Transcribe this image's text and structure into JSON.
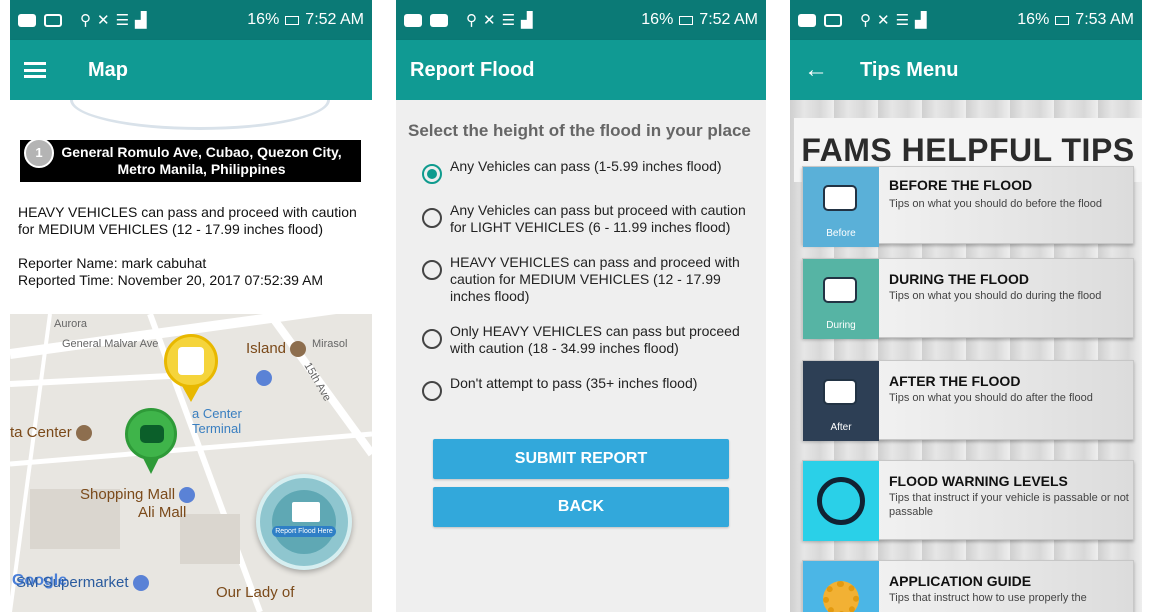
{
  "status": {
    "battery": "16%",
    "time1": "7:52 AM",
    "time2": "7:52 AM",
    "time3": "7:53 AM"
  },
  "map_screen": {
    "title": "Map",
    "compass": "1",
    "address": "General Romulo Ave, Cubao, Quezon City, Metro Manila, Philippines",
    "description": "HEAVY VEHICLES can pass and proceed with caution for MEDIUM VEHICLES (12 - 17.99 inches flood)",
    "reporter": "Reporter Name: mark cabuhat",
    "reported_time": "Reported Time: November 20, 2017 07:52:39 AM",
    "labels": {
      "island": "Island",
      "street1": "General Malvar Ave",
      "street2": "15th Ave",
      "mirasol": "Mirasol",
      "aurora": "Aurora",
      "center": "ta Center",
      "terminal": "a Center Terminal",
      "mall": "Shopping Mall",
      "ali": "Ali Mall",
      "supermarket": "SM Supermarket",
      "lady": "Our Lady of",
      "google": "Google"
    },
    "fab_label": "Report Flood Here"
  },
  "report_screen": {
    "title": "Report Flood",
    "question": "Select the height of the flood in your place",
    "options": [
      "Any Vehicles can pass (1-5.99 inches flood)",
      "Any Vehicles can pass but proceed with caution for LIGHT VEHICLES (6 - 11.99 inches flood)",
      "HEAVY VEHICLES can pass and proceed with caution for MEDIUM VEHICLES (12 - 17.99 inches flood)",
      "Only HEAVY VEHICLES can pass but proceed with caution (18 - 34.99 inches flood)",
      "Don't attempt to pass (35+ inches flood)"
    ],
    "selected_index": 0,
    "submit_label": "SUBMIT REPORT",
    "back_label": "BACK"
  },
  "tips_screen": {
    "title": "Tips Menu",
    "banner": "FAMS HELPFUL TIPS",
    "cards": [
      {
        "title": "BEFORE THE FLOOD",
        "desc": "Tips on what you should do before the flood",
        "tag": "Before",
        "color": "#5ab0d8"
      },
      {
        "title": "DURING THE FLOOD",
        "desc": "Tips on what you should do during the flood",
        "tag": "During",
        "color": "#56b4a4"
      },
      {
        "title": "AFTER THE FLOOD",
        "desc": "Tips on what you should do after the flood",
        "tag": "After",
        "color": "#2d3f55"
      },
      {
        "title": "FLOOD WARNING LEVELS",
        "desc": "Tips that instruct if your vehicle is passable or not passable",
        "tag": "",
        "color": "#2ad0e8"
      },
      {
        "title": "APPLICATION GUIDE",
        "desc": "Tips that instruct how to use properly the",
        "tag": "",
        "color": "#4bb6e6"
      }
    ]
  }
}
